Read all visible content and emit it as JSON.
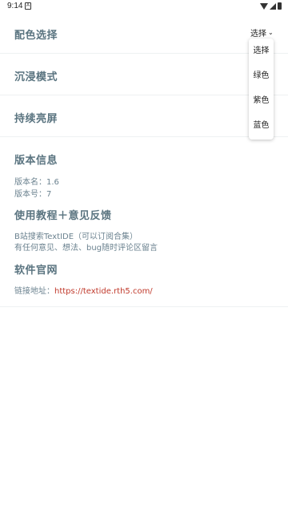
{
  "status_bar": {
    "time": "9:14",
    "app_badge": "A"
  },
  "settings": {
    "color_scheme": {
      "label": "配色选择",
      "selected": "选择"
    },
    "immersive_mode": {
      "label": "沉浸模式"
    },
    "keep_screen_on": {
      "label": "持续亮屏"
    }
  },
  "version_info": {
    "title": "版本信息",
    "version_name": "版本名：1.6",
    "version_code": "版本号：7"
  },
  "tutorial": {
    "title": "使用教程＋意见反馈",
    "line1": "B站搜索TextIDE（可以订阅合集）",
    "line2": "有任何意见、想法、bug随时评论区留言"
  },
  "website": {
    "title": "软件官网",
    "label": "链接地址：",
    "url": "https://textide.rth5.com/"
  },
  "dropdown": {
    "options": [
      "选择",
      "绿色",
      "紫色",
      "蓝色"
    ]
  }
}
